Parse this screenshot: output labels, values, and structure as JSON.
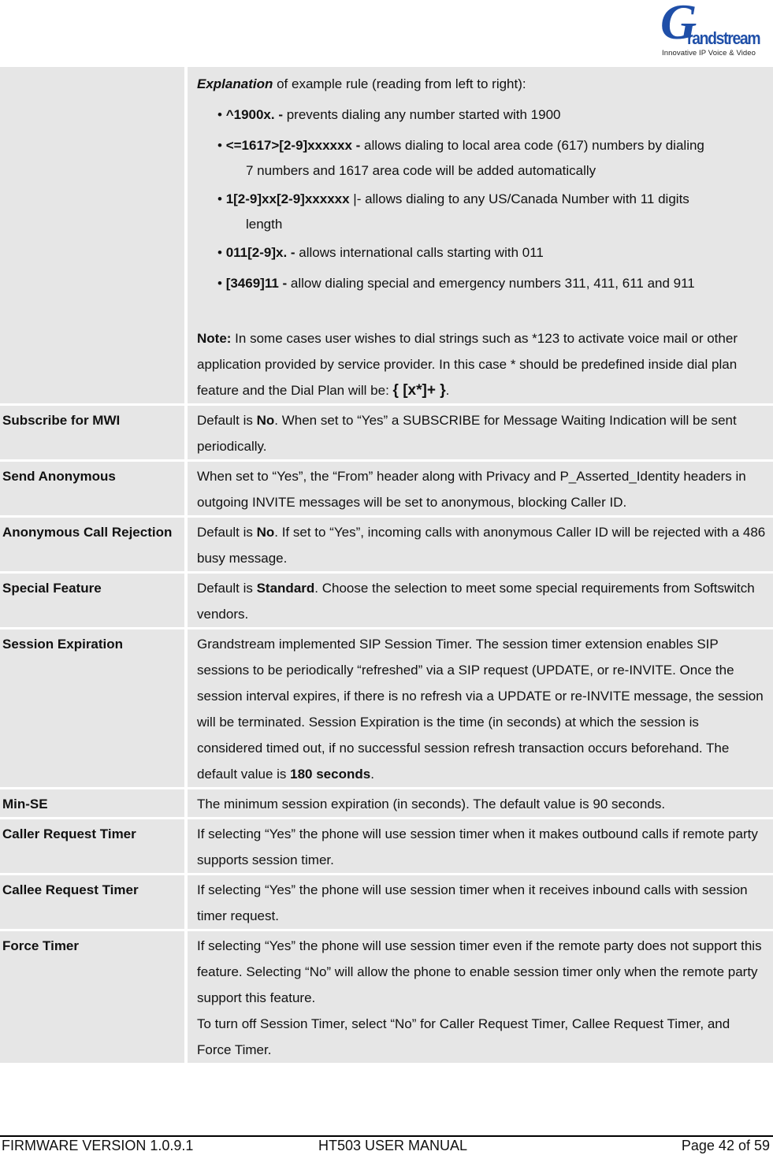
{
  "logo": {
    "brand_initial": "G",
    "brand_rest": "randstream",
    "tagline": "Innovative IP Voice & Video",
    "brand_color": "#1f4fa8"
  },
  "explanation": {
    "intro_bold": "Explanation",
    "intro_rest": " of example rule (reading from left to right):",
    "bullets": [
      {
        "rule": "^1900x. -",
        "text": " prevents dialing any number started with 1900",
        "cont": ""
      },
      {
        "rule": "<=1617>[2-9]xxxxxx  -",
        "text": " allows dialing to local area code (617) numbers by dialing",
        "cont": "7 numbers and 1617 area code will be added automatically"
      },
      {
        "rule": "1[2-9]xx[2-9]xxxxxx",
        "sep": " |- ",
        "text": "allows dialing to any US/Canada Number with 11 digits",
        "cont": "length"
      },
      {
        "rule": "011[2-9]x. -",
        "text": " allows international calls starting with 011",
        "cont": ""
      },
      {
        "rule": "[3469]11 -",
        "text": " allow dialing special and emergency numbers 311, 411, 611 and 911",
        "cont": ""
      }
    ],
    "bullet_char": "•",
    "note_label": "Note:",
    "note_text": "  In some cases user wishes to dial strings such as *123 to activate voice mail or other application provided by service provider. In this case * should be predefined inside dial plan feature and the Dial Plan will be:  ",
    "note_code": "{ [x*]+ }",
    "note_end": "."
  },
  "rows": [
    {
      "name": "Subscribe for MWI",
      "pre": "Default is ",
      "bold": "No",
      "post": ".  When set to “Yes” a SUBSCRIBE for Message Waiting Indication will be sent periodically."
    },
    {
      "name": "Send Anonymous",
      "pre": "When set to “Yes”, the “From” header along with Privacy and P_Asserted_Identity headers in outgoing INVITE messages will be set to anonymous, blocking Caller ID.",
      "bold": "",
      "post": ""
    },
    {
      "name": "Anonymous Call Rejection",
      "pre": "Default is ",
      "bold": "No",
      "post": ".  If set to “Yes”, incoming calls with anonymous Caller ID will be rejected with a 486 busy message."
    },
    {
      "name": "Special Feature",
      "pre": "Default is ",
      "bold": "Standard",
      "post": ". Choose the selection to meet some special requirements from Softswitch vendors."
    },
    {
      "name": "Session Expiration",
      "pre": "Grandstream implemented SIP Session Timer. The session timer extension enables SIP sessions to be periodically “refreshed” via a SIP request (UPDATE, or re-INVITE. Once the session interval expires, if there is no refresh via a UPDATE or re-INVITE message, the session will be terminated. Session Expiration is the time (in seconds) at which the session is considered timed out, if no successful session refresh transaction occurs beforehand. The default value is ",
      "bold": "180 seconds",
      "post": "."
    },
    {
      "name": "Min-SE",
      "pre": "The minimum session expiration (in seconds).  The default value is 90 seconds.",
      "bold": "",
      "post": ""
    },
    {
      "name": "Caller Request Timer",
      "pre": "If selecting “Yes” the phone will use session timer when it makes outbound calls if remote party supports session timer.",
      "bold": "",
      "post": ""
    },
    {
      "name": "Callee Request Timer",
      "pre": "If selecting “Yes” the phone will use session timer when it receives inbound calls with session timer request.",
      "bold": "",
      "post": ""
    },
    {
      "name": "Force Timer",
      "pre": "If selecting “Yes” the phone will use session timer even if the remote party does not support this feature. Selecting “No” will allow the phone to enable session timer only when the remote party support this feature.",
      "bold": "",
      "post": "",
      "extra": "To turn off Session Timer, select “No” for Caller Request Timer, Callee Request Timer, and Force Timer."
    }
  ],
  "footer": {
    "firmware": "FIRMWARE VERSION 1.0.9.1",
    "title": "HT503 USER MANUAL",
    "page": "Page 42 of 59"
  }
}
